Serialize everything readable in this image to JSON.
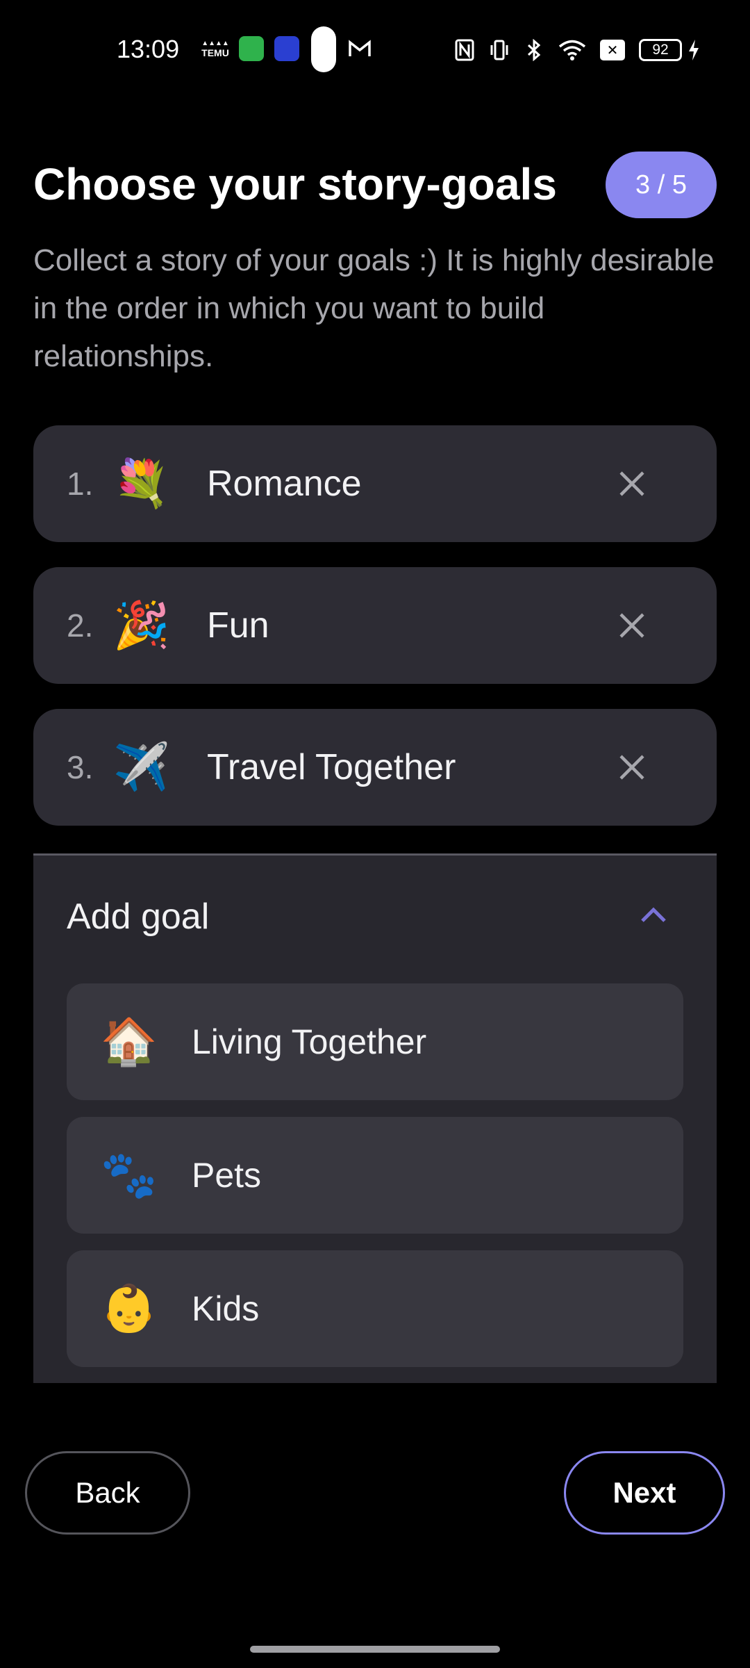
{
  "status_bar": {
    "time": "13:09",
    "temu_top": "▲▲▲▲",
    "temu_bottom": "TEMU",
    "battery": "92",
    "icons": [
      "temu-icon",
      "green-app-icon",
      "blue-app-icon",
      "gmail-icon",
      "nfc-icon",
      "vibrate-icon",
      "bluetooth-icon",
      "wifi-icon",
      "x-icon",
      "battery-icon",
      "charging-icon"
    ]
  },
  "header": {
    "title": "Choose your story-goals",
    "step": "3 / 5",
    "subtitle": "Collect a story of your goals :) It is highly desirable in the order in which you want to build relationships."
  },
  "selected_goals": [
    {
      "number": "1.",
      "emoji": "💐",
      "label": "Romance"
    },
    {
      "number": "2.",
      "emoji": "🎉",
      "label": "Fun"
    },
    {
      "number": "3.",
      "emoji": "✈️",
      "label": "Travel Together"
    }
  ],
  "add_goal": {
    "title": "Add goal",
    "options": [
      {
        "emoji": "🏠",
        "label": "Living Together"
      },
      {
        "emoji": "🐾",
        "label": "Pets"
      },
      {
        "emoji": "👶",
        "label": "Kids"
      }
    ]
  },
  "nav": {
    "back_label": "Back",
    "next_label": "Next"
  },
  "colors": {
    "accent": "#8a87f0",
    "card": "#2d2c34",
    "panel": "#28272e",
    "option": "#38373f",
    "muted_text": "#a7a7ad"
  }
}
